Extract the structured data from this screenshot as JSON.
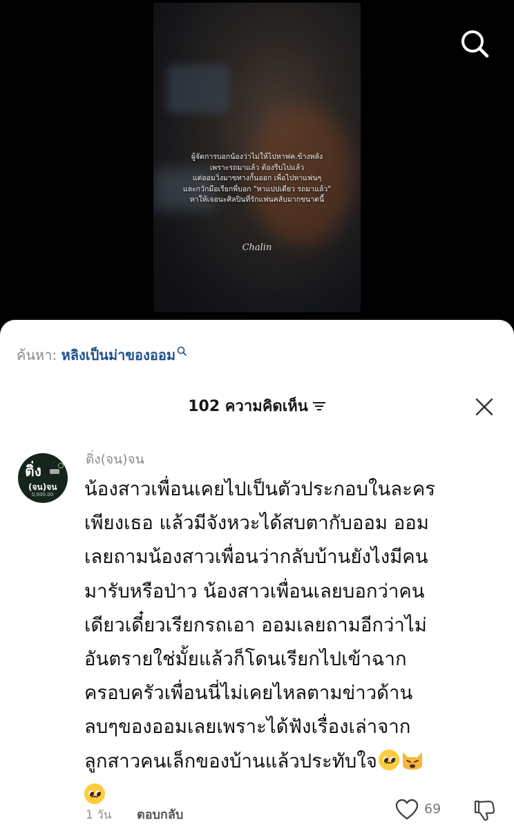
{
  "video": {
    "caption_lines": [
      "ผู้จัดการบอกน้องว่าไม่ให้ไปหาฟค.ข้างหลัง",
      "เพราะรถมาแล้ว ต้องรีบไปแล้ว",
      "แต่ออมวิ่งมาขทางกั้นออก เพื่อไปหาแฟนๆ",
      "และกวักมือเรียกพี่บอก \"หาแปปเดียว รถมาแล้ว\"",
      "หาให้เจอนะศิลปินที่รักแฟนคลับมากขนาดนี้"
    ],
    "watermark": "Chalin"
  },
  "search": {
    "prefix": "ค้นหา:",
    "query": "หลิงเป็นม่าของออม"
  },
  "comments_header": {
    "title": "102 ความคิดเห็น"
  },
  "comment": {
    "avatar": {
      "line1": "ติ่ง",
      "line2": "(จน)จน",
      "line3": "0,000.00"
    },
    "username": "ติ่ง(จน)จน",
    "lines": [
      "น้องสาวเพื่อนเคยไปเป็นตัวประกอบในละคร",
      "เพียงเธอ แล้วมีจังหวะได้สบตากับออม ออม",
      "เลยถามน้องสาวเพื่อนว่ากลับบ้านยังไงมีคน",
      "มารับหรือป่าว น้องสาวเพื่อนเลยบอกว่าคน",
      "เดียวเดี๋ยวเรียกรถเอา ออมเลยถามอีกว่าไม่",
      "อันตรายใช่มั้ยแล้วก็โดนเรียกไปเข้าฉาก",
      "ครอบครัวเพื่อนนี่ไม่เคยไหลตามข่าวด้าน",
      "ลบๆของออมเลยเพราะได้ฟังเรื่องเล่าจาก",
      "ลูกสาวคนเล็กของบ้านแล้วประทับใจ"
    ],
    "emojis": [
      "pleading-face",
      "weary-cat",
      "pleading-face"
    ],
    "time": "1 วัน",
    "reply_label": "ตอบกลับ",
    "like_count": "69"
  }
}
